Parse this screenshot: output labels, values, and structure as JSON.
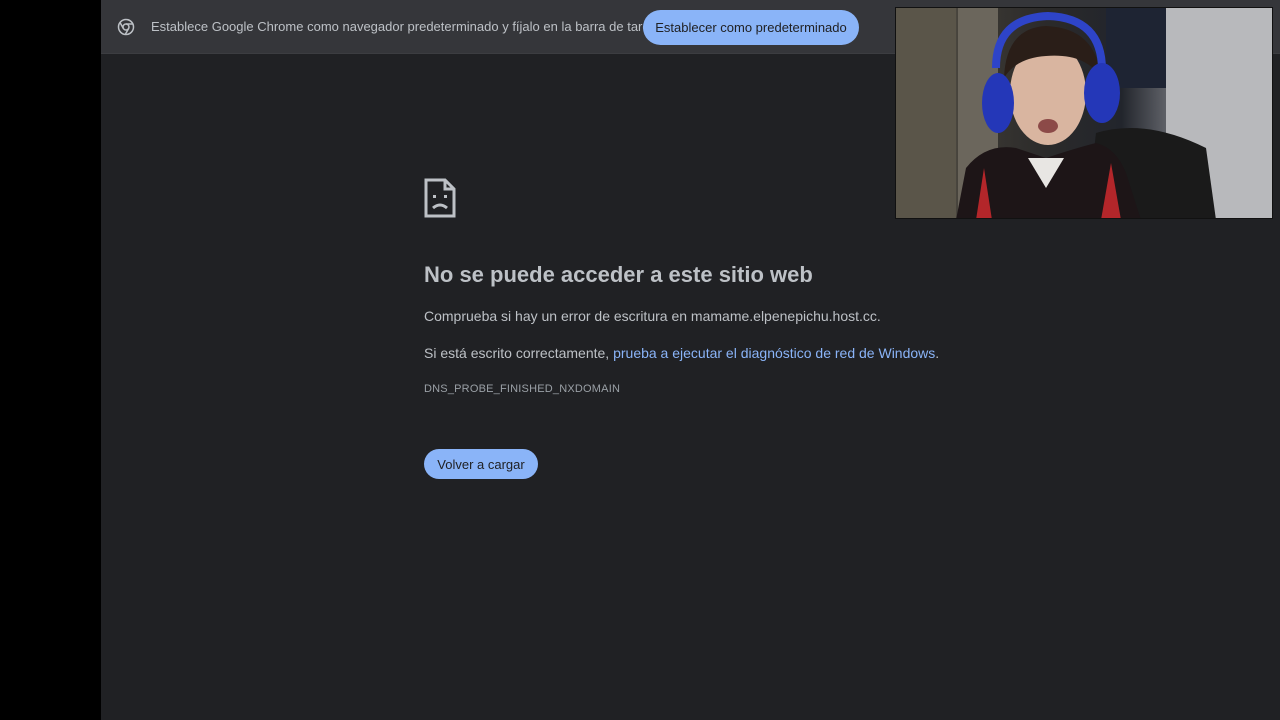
{
  "infobar": {
    "message": "Establece Google Chrome como navegador predeterminado y fíjalo en la barra de tareas",
    "button_label": "Establecer como predeterminado",
    "icon": "chrome-icon"
  },
  "error_page": {
    "icon": "sad-document-icon",
    "title": "No se puede acceder a este sitio web",
    "check_prefix": "Comprueba si hay un error de escritura en ",
    "domain": "mamame.elpenepichu.host.cc",
    "check_suffix": ".",
    "retry_prefix": "Si está escrito correctamente, ",
    "diagnostics_link": "prueba a ejecutar el diagnóstico de red de Windows",
    "retry_suffix": ".",
    "error_code": "DNS_PROBE_FINISHED_NXDOMAIN",
    "reload_label": "Volver a cargar"
  },
  "webcam_overlay": {
    "description_visible": false
  },
  "colors": {
    "background": "#202124",
    "infobar": "#35363a",
    "accent": "#8ab4f8",
    "text": "#bdc1c6"
  }
}
